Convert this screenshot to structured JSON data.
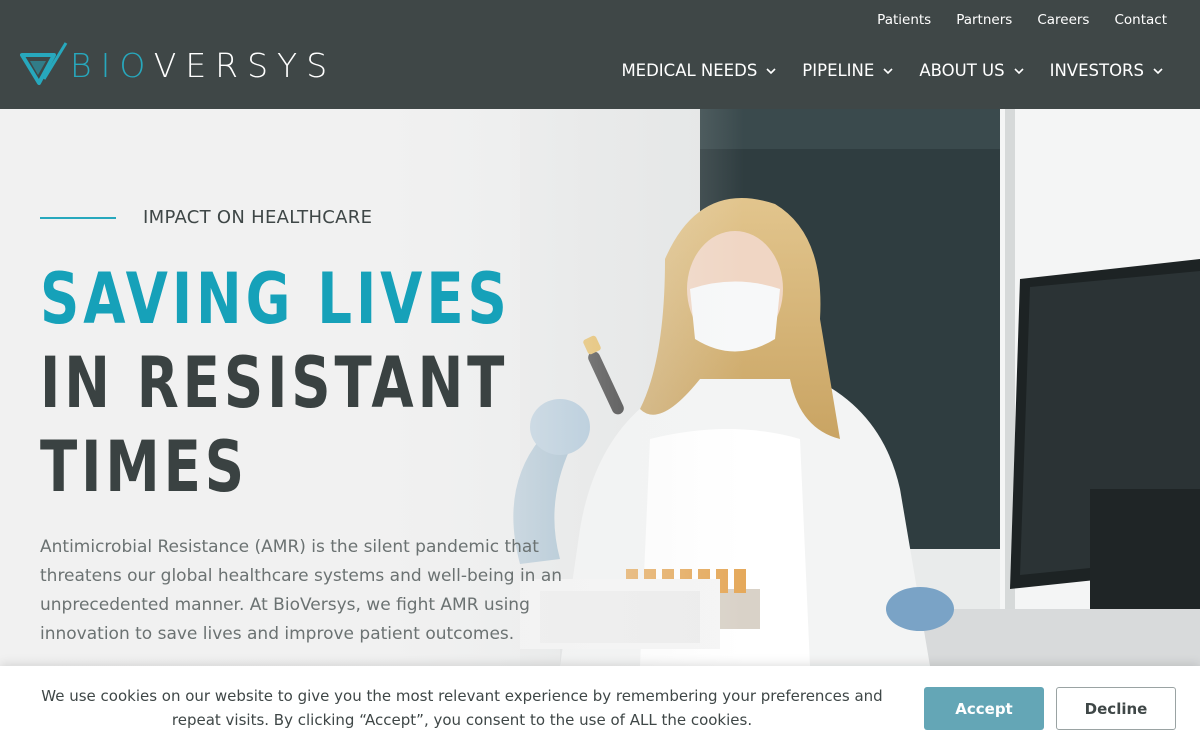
{
  "brand": {
    "prefix": "BIO",
    "suffix": "VERSYS",
    "accent_color": "#27a8bd",
    "header_bg": "#3f4747"
  },
  "top_links": [
    "Patients",
    "Partners",
    "Careers",
    "Contact"
  ],
  "main_nav": [
    {
      "label": "MEDICAL NEEDS",
      "icon": "chevron-down-icon"
    },
    {
      "label": "PIPELINE",
      "icon": "chevron-down-icon"
    },
    {
      "label": "ABOUT US",
      "icon": "chevron-down-icon"
    },
    {
      "label": "INVESTORS",
      "icon": "chevron-down-icon"
    }
  ],
  "hero": {
    "kicker": "IMPACT ON HEALTHCARE",
    "headline": [
      "SAVING LIVES",
      "IN RESISTANT",
      "TIMES"
    ],
    "intro": "Antimicrobial Resistance (AMR) is the silent pandemic that threatens our global healthcare systems and well-being in an unprecedented manner. At BioVersys, we fight AMR using innovation to save lives and improve patient outcomes."
  },
  "cookie": {
    "text": "We use cookies on our website to give you the most relevant experience by remembering your preferences and repeat visits. By clicking “Accept”, you consent to the use of ALL the cookies.",
    "accept_label": "Accept",
    "decline_label": "Decline",
    "accept_color": "#64a6b6"
  }
}
